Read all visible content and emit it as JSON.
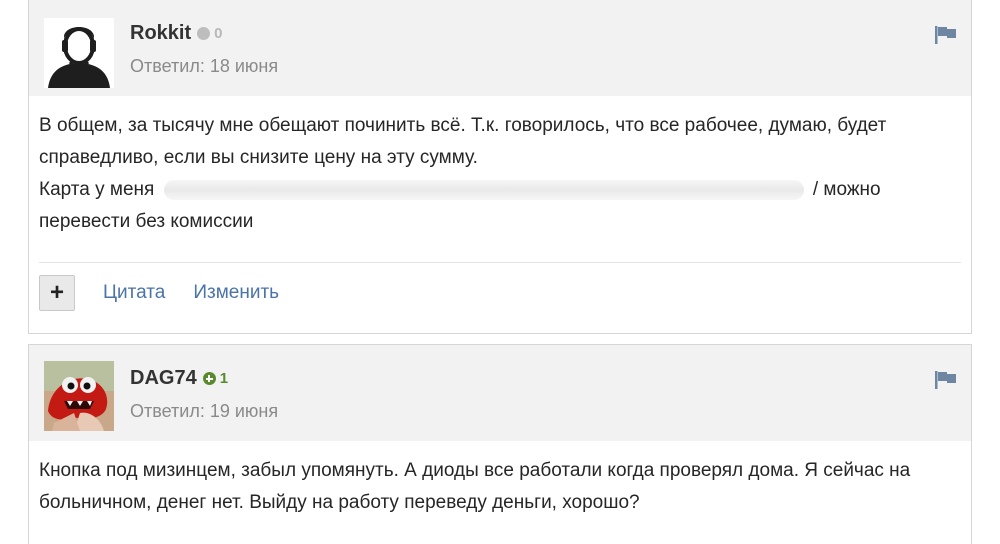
{
  "posts": [
    {
      "author": "Rokkit",
      "reputation": "0",
      "reputation_state": "neutral",
      "replied": "Ответил: 18 июня",
      "avatar": "default-user-silhouette-icon",
      "body": {
        "line1": "В общем, за тысячу мне обещают починить всё. Т.к. говорилось, что все рабочее, думаю, будет справедливо, если вы снизите цену на эту сумму.",
        "line2_prefix": "Карта у меня",
        "line2_suffix": "/ можно перевести без комиссии"
      },
      "controls": {
        "plus_label": "+",
        "quote_label": "Цитата",
        "edit_label": "Изменить"
      }
    },
    {
      "author": "DAG74",
      "reputation": "1",
      "reputation_state": "positive",
      "replied": "Ответил: 19 июня",
      "avatar": "red-monster-avatar",
      "body": {
        "line1": "Кнопка под мизинцем, забыл упомянуть. А диоды все работали когда проверял дома. Я сейчас на больничном, денег нет. Выйду на работу переведу деньги, хорошо?"
      }
    }
  ],
  "colors": {
    "header_bg": "#f2f2f2",
    "link": "#4a74a8",
    "rep_positive": "#5a8a2e",
    "rep_neutral": "#bdbdbd",
    "muted_text": "#8a8a8a"
  },
  "icons": {
    "flag": "flag-icon",
    "rep": "reputation-dot-icon"
  }
}
